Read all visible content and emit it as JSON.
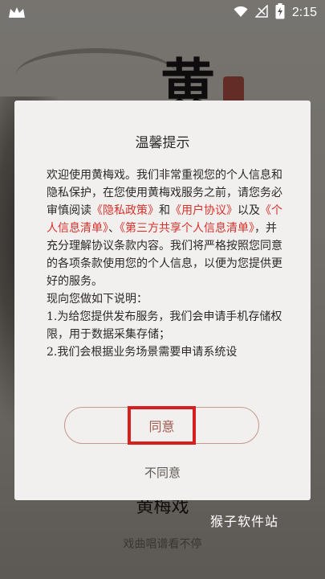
{
  "status_bar": {
    "time": "2:15"
  },
  "background": {
    "big_char": "黄",
    "app_title": "黄梅戏",
    "tagline": "戏曲唱谱看不停"
  },
  "dialog": {
    "title": "温馨提示",
    "para1_a": "欢迎使用黄梅戏。我们非常重视您的个人信息和隐私保护，在您使用黄梅戏服务之前，请您务必审慎阅读",
    "privacy_link": "《隐私政策》",
    "and1": "和",
    "agreement_link": "《用户协议》",
    "and2": "以及",
    "info_list_link": "《个人信息清单》",
    "sep": "、",
    "third_party_link": "《第三方共享个人信息清单》",
    "para1_b": "，并充分理解协议条款内容。我们将严格按照您同意的各项条款使用您的个人信息，以便为您提供更好的服务。",
    "explain_title": " 现向您做如下说明：",
    "item1": " 1.为给您提供发布服务，我们会申请手机存储权限，用于数据采集存储；",
    "item2": " 2.我们会根据业务场景需要申请系统设",
    "agree_label": "同意",
    "disagree_label": "不同意"
  },
  "watermark": "猴子软件站",
  "colors": {
    "link_red": "#d6312c",
    "highlight_box": "#d62020"
  }
}
